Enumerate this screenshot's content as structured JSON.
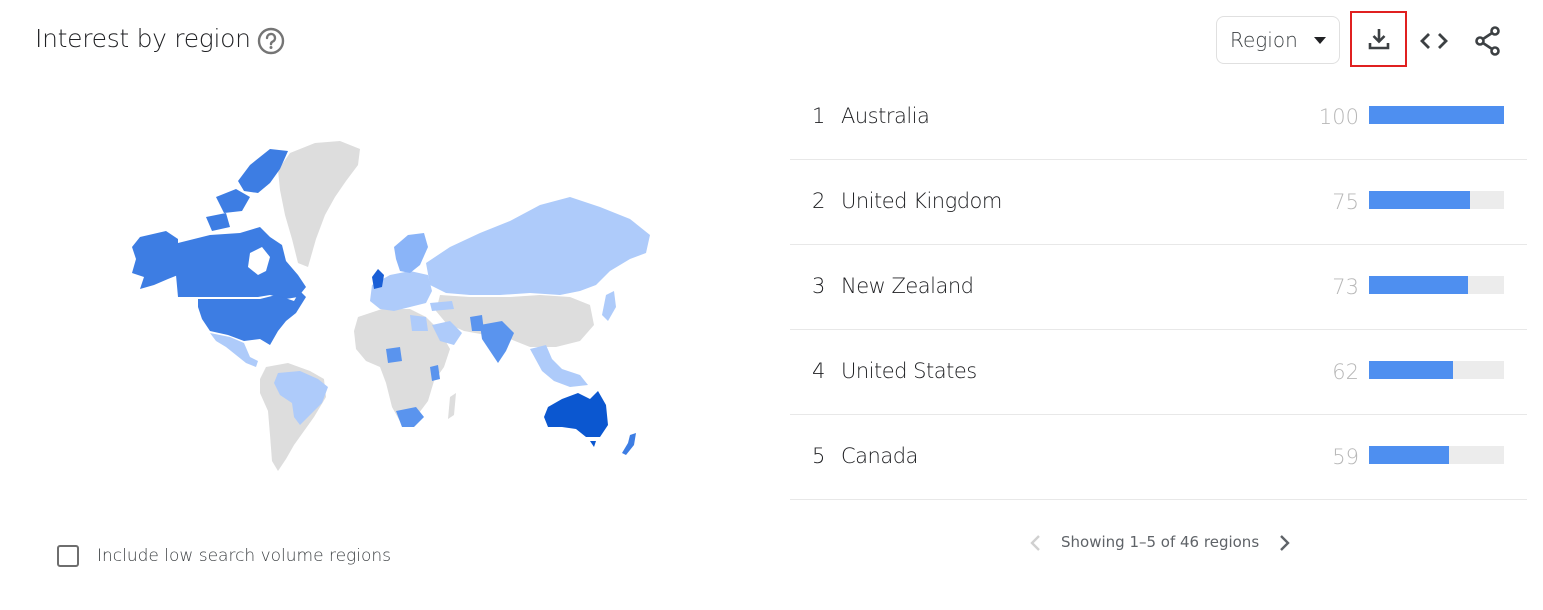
{
  "header": {
    "title": "Interest by region",
    "help_icon": "help-circle-icon",
    "resolution_dropdown": {
      "selected": "Region"
    },
    "actions": [
      {
        "name": "download",
        "icon": "download-icon",
        "highlighted": true,
        "highlight_color": "#e02020"
      },
      {
        "name": "embed",
        "icon": "code-embed-icon"
      },
      {
        "name": "share",
        "icon": "share-icon"
      }
    ]
  },
  "colors": {
    "bar_fill": "#4e8ff0",
    "bar_track": "#ececec",
    "map_no_data": "#dddddd",
    "map_scale": [
      "#aecbfa",
      "#8ab4f8",
      "#5a94ee",
      "#3d7de3",
      "#1a5fd6",
      "#0b57d0"
    ]
  },
  "regions": {
    "rows": [
      {
        "rank": "1",
        "name": "Australia",
        "value": "100",
        "fraction": 1.0
      },
      {
        "rank": "2",
        "name": "United Kingdom",
        "value": "75",
        "fraction": 0.75
      },
      {
        "rank": "3",
        "name": "New Zealand",
        "value": "73",
        "fraction": 0.73
      },
      {
        "rank": "4",
        "name": "United States",
        "value": "62",
        "fraction": 0.62
      },
      {
        "rank": "5",
        "name": "Canada",
        "value": "59",
        "fraction": 0.59
      }
    ],
    "pagination": {
      "text": "Showing 1–5 of 46 regions",
      "prev_enabled": false,
      "next_enabled": true
    }
  },
  "low_volume": {
    "label": "Include low search volume regions",
    "checked": false
  },
  "map": {
    "legend_levels": {
      "Australia": 100,
      "United Kingdom": 75,
      "New Zealand": 73,
      "United States": 62,
      "Canada": 59,
      "South Africa": "mid",
      "India": "mid",
      "Nigeria": "mid",
      "Kenya": "mid",
      "Russia": "low",
      "Brazil": "low",
      "Europe": "low",
      "Saudi Arabia": "low",
      "Egypt": "low",
      "Japan": "low",
      "Southeast Asia": "low",
      "Mexico": "low"
    }
  }
}
